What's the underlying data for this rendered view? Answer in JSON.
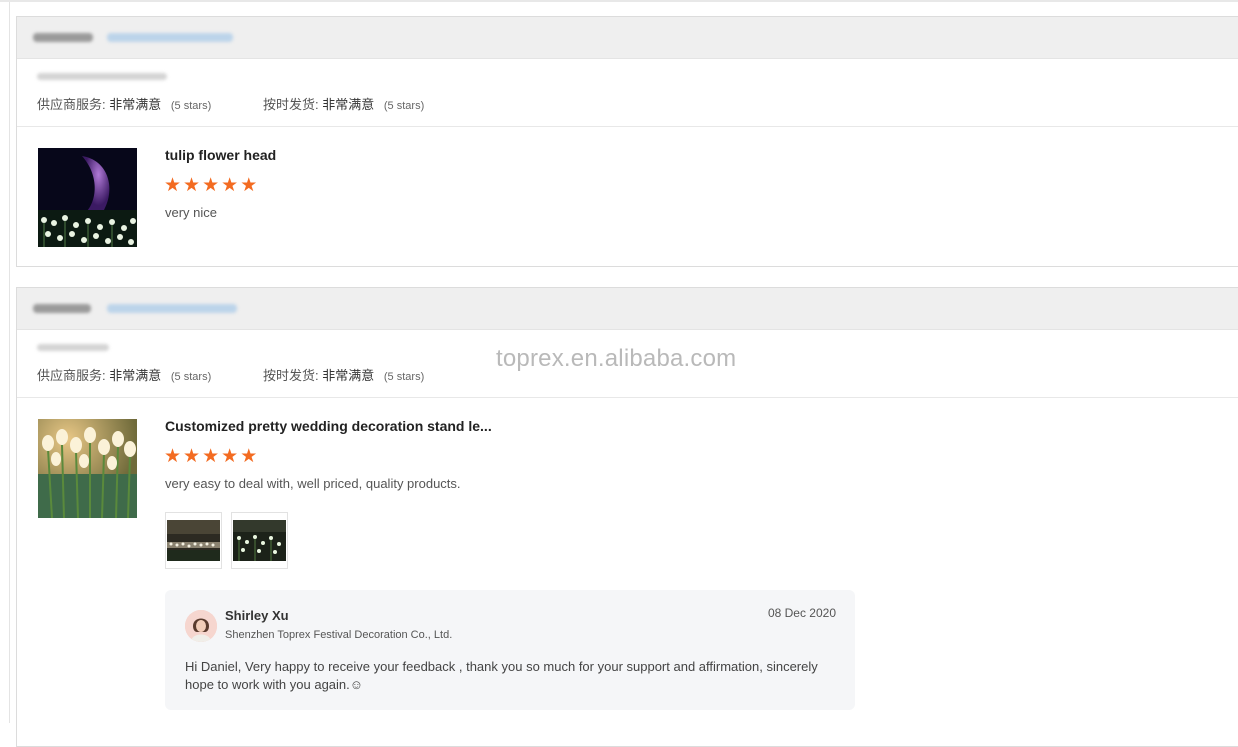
{
  "reviews": [
    {
      "ratings": {
        "supplier_service": {
          "label": "供应商服务:",
          "value": "非常满意",
          "stars": "(5 stars)"
        },
        "on_time_shipment": {
          "label": "按时发货:",
          "value": "非常满意",
          "stars": "(5 stars)"
        }
      },
      "product_title": "tulip flower head",
      "rating_stars": 5,
      "comment": "very nice"
    },
    {
      "ratings": {
        "supplier_service": {
          "label": "供应商服务:",
          "value": "非常满意",
          "stars": "(5 stars)"
        },
        "on_time_shipment": {
          "label": "按时发货:",
          "value": "非常满意",
          "stars": "(5 stars)"
        }
      },
      "product_title": "Customized pretty wedding decoration stand le...",
      "rating_stars": 5,
      "comment": "very easy to deal with, well priced, quality products.",
      "reply": {
        "name": "Shirley Xu",
        "company": "Shenzhen Toprex Festival Decoration Co., Ltd.",
        "date": "08 Dec 2020",
        "text": "Hi Daniel, Very happy to receive your feedback , thank you so much for your support and affirmation, sincerely hope to work with you again.☺"
      }
    }
  ],
  "watermark": "toprex.en.alibaba.com",
  "colors": {
    "star": "#f36b21",
    "header_bg": "#efefef",
    "reply_bg": "#f5f6f8"
  },
  "icons": {
    "star": "star-icon"
  }
}
